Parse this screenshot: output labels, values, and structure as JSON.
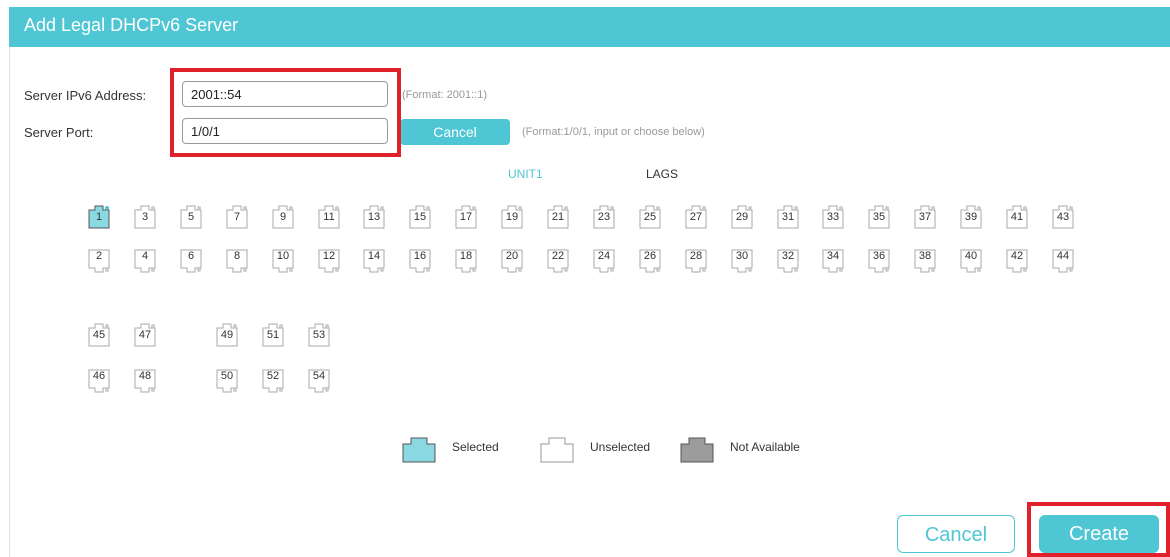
{
  "dialog": {
    "title": "Add Legal DHCPv6 Server"
  },
  "form": {
    "ipv6_label": "Server IPv6 Address:",
    "ipv6_value": "2001::54",
    "ipv6_hint": "(Format: 2001::1)",
    "port_label": "Server Port:",
    "port_value": "1/0/1",
    "port_cancel": "Cancel",
    "port_hint": "(Format:1/0/1, input or choose below)"
  },
  "tabs": [
    "UNIT1",
    "LAGS"
  ],
  "ports": {
    "top_row": [
      "1",
      "3",
      "5",
      "7",
      "9",
      "11",
      "13",
      "15",
      "17",
      "19",
      "21",
      "23",
      "25",
      "27",
      "29",
      "31",
      "33",
      "35",
      "37",
      "39",
      "41",
      "43"
    ],
    "bottom_row": [
      "2",
      "4",
      "6",
      "8",
      "10",
      "12",
      "14",
      "16",
      "18",
      "20",
      "22",
      "24",
      "26",
      "28",
      "30",
      "32",
      "34",
      "36",
      "38",
      "40",
      "42",
      "44"
    ],
    "sfp_top_a": [
      "45",
      "47"
    ],
    "sfp_top_b": [
      "49",
      "51",
      "53"
    ],
    "sfp_bot_a": [
      "46",
      "48"
    ],
    "sfp_bot_b": [
      "50",
      "52",
      "54"
    ],
    "selected": [
      "1"
    ]
  },
  "legend": {
    "selected": "Selected",
    "unselected": "Unselected",
    "not_available": "Not Available"
  },
  "footer": {
    "cancel": "Cancel",
    "create": "Create"
  },
  "colors": {
    "accent": "#4fc6d3",
    "highlight": "#e0202a",
    "selected_fill": "#8ad9e2",
    "unavailable_fill": "#9c9c9c"
  }
}
